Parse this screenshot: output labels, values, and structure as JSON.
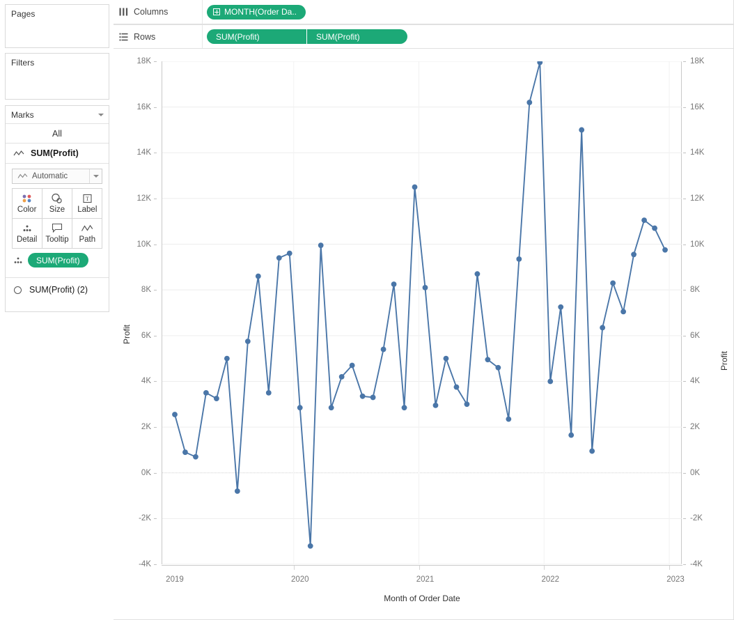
{
  "left_panel": {
    "pages": {
      "title": "Pages"
    },
    "filters": {
      "title": "Filters"
    },
    "marks": {
      "title": "Marks",
      "all_label": "All",
      "selected_card_label": "SUM(Profit)",
      "mark_type": "Automatic",
      "buttons": [
        {
          "label": "Color",
          "icon": "color-palette-icon"
        },
        {
          "label": "Size",
          "icon": "size-icon"
        },
        {
          "label": "Label",
          "icon": "label-icon"
        },
        {
          "label": "Detail",
          "icon": "detail-icon"
        },
        {
          "label": "Tooltip",
          "icon": "tooltip-icon"
        },
        {
          "label": "Path",
          "icon": "path-icon"
        }
      ],
      "detail_pill": "SUM(Profit)",
      "second_card_label": "SUM(Profit) (2)"
    }
  },
  "shelves": {
    "columns": {
      "label": "Columns",
      "pills": [
        "MONTH(Order Da.."
      ]
    },
    "rows": {
      "label": "Rows",
      "pills": [
        "SUM(Profit)",
        "SUM(Profit)"
      ]
    }
  },
  "colors": {
    "pill_green": "#1ca977",
    "line_blue": "#4a76a8",
    "axis_text": "#767676",
    "gridline": "#ededed",
    "zero_line": "#cfcfcf"
  },
  "chart_data": {
    "type": "line",
    "title": "",
    "xlabel": "Month of Order Date",
    "ylabel": "Profit",
    "ylabel_right": "Profit",
    "ylim": [
      -4000,
      18000
    ],
    "ytick_values": [
      18000,
      16000,
      14000,
      12000,
      10000,
      8000,
      6000,
      4000,
      2000,
      0,
      -2000,
      -4000
    ],
    "ytick_labels": [
      "18K",
      "16K",
      "14K",
      "12K",
      "10K",
      "8K",
      "6K",
      "4K",
      "2K",
      "0K",
      "-2K",
      "-4K"
    ],
    "xtick_labels": [
      "2019",
      "2020",
      "2021",
      "2022",
      "2023"
    ],
    "xtick_values": [
      0,
      12,
      24,
      36,
      48
    ],
    "grid": true,
    "legend": "none",
    "marks": "circle",
    "series": [
      {
        "name": "SUM(Profit)",
        "x": [
          0,
          1,
          2,
          3,
          4,
          5,
          6,
          7,
          8,
          9,
          10,
          11,
          12,
          13,
          14,
          15,
          16,
          17,
          18,
          19,
          20,
          21,
          22,
          23,
          24,
          25,
          26,
          27,
          28,
          29,
          30,
          31,
          32,
          33,
          34,
          35,
          36,
          37,
          38,
          39,
          40,
          41,
          42,
          43,
          44,
          45,
          46,
          47
        ],
        "values": [
          2550,
          900,
          700,
          3500,
          3250,
          5000,
          -800,
          5750,
          8600,
          3500,
          9400,
          9600,
          2850,
          -3200,
          9950,
          2850,
          4200,
          4700,
          3350,
          3300,
          5400,
          8250,
          2850,
          12500,
          8100,
          2950,
          5000,
          3750,
          3000,
          8700,
          4950,
          4600,
          2350,
          9350,
          16200,
          17950,
          4000,
          7250,
          1650,
          15000,
          950,
          6350,
          8300,
          7050,
          9550,
          11050,
          10700,
          9750
        ]
      }
    ]
  }
}
